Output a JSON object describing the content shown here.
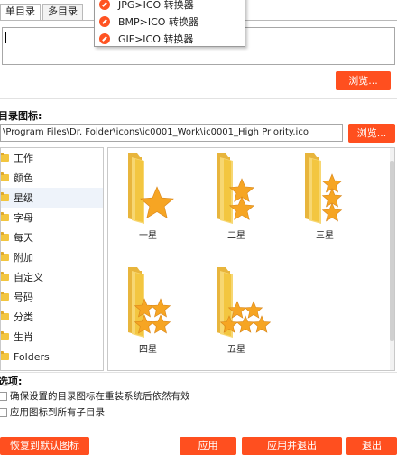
{
  "tabs": [
    {
      "label": "单目录"
    },
    {
      "label": "多目录"
    }
  ],
  "context_menu": {
    "items": [
      {
        "label": "JPG>ICO 转换器"
      },
      {
        "label": "BMP>ICO 转换器"
      },
      {
        "label": "GIF>ICO 转换器"
      }
    ]
  },
  "dir_input": {
    "value": ""
  },
  "browse_label": "浏览...",
  "icon_section": {
    "label": "目录图标:",
    "path": "\\Program Files\\Dr. Folder\\icons\\ic0001_Work\\ic0001_High Priority.ico",
    "browse_label": "浏览..."
  },
  "categories": [
    {
      "label": "工作"
    },
    {
      "label": "颜色"
    },
    {
      "label": "星级"
    },
    {
      "label": "字母"
    },
    {
      "label": "每天"
    },
    {
      "label": "附加"
    },
    {
      "label": "自定义"
    },
    {
      "label": "号码"
    },
    {
      "label": "分类"
    },
    {
      "label": "生肖"
    },
    {
      "label": "Folders"
    }
  ],
  "icons": [
    {
      "label": "一星",
      "stars": 1
    },
    {
      "label": "二星",
      "stars": 2
    },
    {
      "label": "三星",
      "stars": 3
    },
    {
      "label": "四星",
      "stars": 4
    },
    {
      "label": "五星",
      "stars": 5
    }
  ],
  "options": {
    "label": "选项:",
    "opt1": "确保设置的目录图标在重装系统后依然有效",
    "opt2": "应用图标到所有子目录"
  },
  "buttons": {
    "restore": "恢复到默认图标",
    "apply": "应用",
    "apply_exit": "应用并退出",
    "exit": "退出"
  },
  "colors": {
    "accent": "#ff4f1f",
    "folder": "#f3c640",
    "star": "#f6a523"
  }
}
